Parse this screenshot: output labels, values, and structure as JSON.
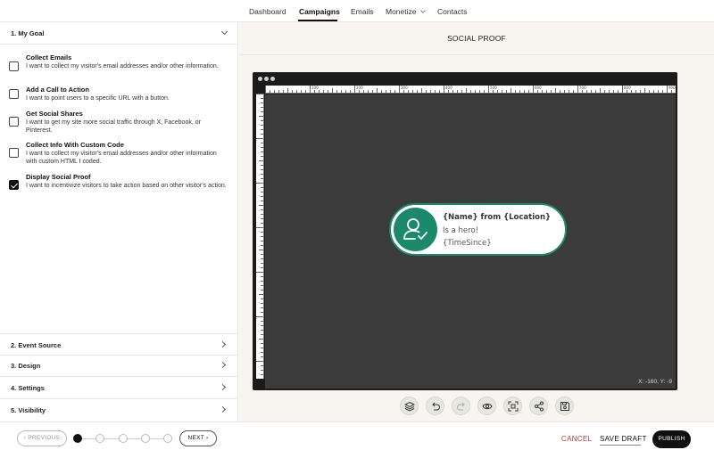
{
  "nav": {
    "items": [
      "Dashboard",
      "Campaigns",
      "Emails",
      "Monetize",
      "Contacts"
    ],
    "active": "Campaigns"
  },
  "left": {
    "goal_section": "1. My Goal",
    "goals": [
      {
        "title": "Collect Emails",
        "desc": "I want to collect my visitor's email addresses and/or other information.",
        "checked": false
      },
      {
        "title": "Add a Call to Action",
        "desc": "I want to point users to a specific URL with a button.",
        "checked": false
      },
      {
        "title": "Get Social Shares",
        "desc": "I want to get my site more social traffic through X, Facebook, or Pinterest.",
        "checked": false
      },
      {
        "title": "Collect Info With Custom Code",
        "desc": "I want to collect my visitor's email addresses and/or other information with custom HTML I coded.",
        "checked": false
      },
      {
        "title": "Display Social Proof",
        "desc": "I want to incentivize visitors to take action based on other visitor's action.",
        "checked": true
      }
    ],
    "sections": [
      "2. Event Source",
      "3. Design",
      "4. Settings",
      "5. Visibility"
    ]
  },
  "editor": {
    "title": "SOCIAL PROOF",
    "ruler_labels": [
      "100",
      "200",
      "300",
      "400",
      "500",
      "600",
      "700",
      "800",
      "900"
    ],
    "coords": "X: -160, Y: -9",
    "popup": {
      "name": "{Name} from {Location}",
      "message": "Is a hero!",
      "time": "{TimeSince}",
      "accent": "#1b8a6b"
    },
    "toolbar": [
      "layers-icon",
      "undo-icon",
      "redo-icon",
      "preview-eye-icon",
      "fit-screen-icon",
      "share-icon",
      "save-icon"
    ]
  },
  "footer": {
    "previous": "PREVIOUS",
    "next": "NEXT",
    "steps_total": 5,
    "step_active": 1,
    "cancel": "CANCEL",
    "save_draft": "SAVE DRAFT",
    "publish": "PUBLISH"
  }
}
